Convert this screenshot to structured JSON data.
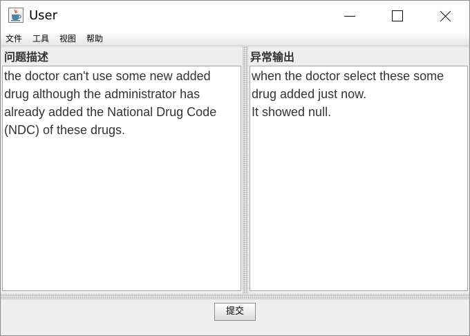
{
  "window": {
    "title": "User",
    "icon": "java-coffee-cup-icon",
    "controls": {
      "minimize_icon": "minimize-icon",
      "maximize_icon": "maximize-icon",
      "close_icon": "close-icon"
    }
  },
  "menubar": {
    "items": [
      {
        "label": "文件"
      },
      {
        "label": "工具"
      },
      {
        "label": "视图"
      },
      {
        "label": "帮助"
      }
    ]
  },
  "left_pane": {
    "label": "问题描述",
    "text": "the doctor can't use some new added\ndrug although the administrator has\nalready added the National Drug Code\n(NDC) of these drugs."
  },
  "right_pane": {
    "label": "异常输出",
    "text": "when the doctor select these some\ndrug added just now.\nIt showed null."
  },
  "actions": {
    "submit_label": "提交"
  },
  "colors": {
    "window_bg": "#eeeeee",
    "text_area_bg": "#ffffff",
    "text": "#333333",
    "border": "#a6a6a6"
  }
}
